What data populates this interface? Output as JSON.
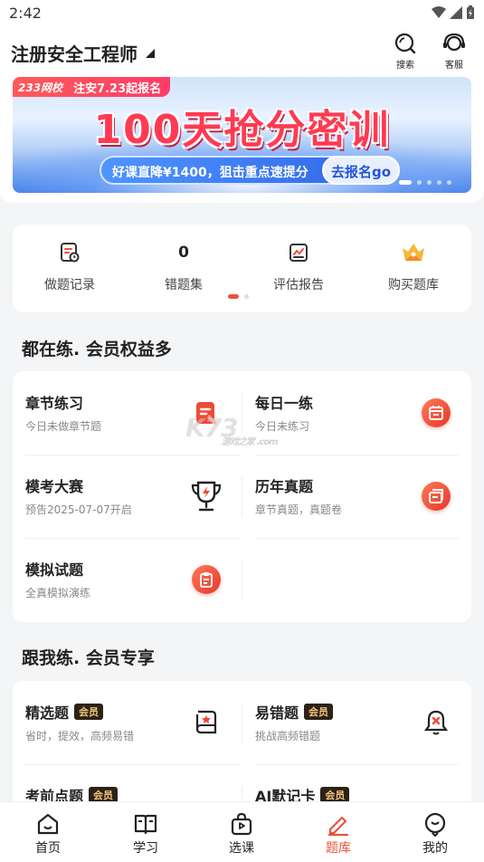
{
  "status_bar": {
    "time": "2:42"
  },
  "header": {
    "title": "注册安全工程师",
    "search_label": "搜索",
    "service_label": "客服"
  },
  "banner": {
    "logo": "233网校",
    "tag": "注安7.23起报名",
    "headline": "100天抢分密训",
    "subline": "好课直降¥1400，狙击重点速提分",
    "cta": "去报名go",
    "page_count": 5,
    "active_page": 1
  },
  "quick_actions": {
    "items": [
      {
        "icon": "record-icon",
        "label": "做题记录"
      },
      {
        "value": "0",
        "label": "错题集"
      },
      {
        "icon": "report-icon",
        "label": "评估报告"
      },
      {
        "icon": "crown-icon",
        "label": "购买题库"
      }
    ]
  },
  "section_practice": {
    "title": "都在练. 会员权益多",
    "items": [
      {
        "title": "章节练习",
        "desc": "今日未做章节题",
        "icon": "chapter-icon"
      },
      {
        "title": "每日一练",
        "desc": "今日未练习",
        "icon": "calendar-icon"
      },
      {
        "title": "模考大赛",
        "desc": "预告2025-07-07开启",
        "icon": "trophy-icon"
      },
      {
        "title": "历年真题",
        "desc": "章节真题，真题卷",
        "icon": "history-icon"
      },
      {
        "title": "模拟试题",
        "desc": "全真模拟演练",
        "icon": "clipboard-icon"
      }
    ]
  },
  "section_vip": {
    "title": "跟我练. 会员专享",
    "badge": "会员",
    "items": [
      {
        "title": "精选题",
        "desc": "省时，提效，高频易错",
        "icon": "star-doc-icon"
      },
      {
        "title": "易错题",
        "desc": "挑战高频错题",
        "icon": "bell-x-icon"
      },
      {
        "title": "考前点题",
        "icon": "exam-icon"
      },
      {
        "title": "AI默记卡",
        "icon": "sparkle-icon"
      }
    ]
  },
  "watermark": {
    "text": "K73",
    "sub": "游戏之家 .com"
  },
  "tabbar": {
    "tabs": [
      {
        "label": "首页",
        "icon": "home-icon"
      },
      {
        "label": "学习",
        "icon": "book-icon"
      },
      {
        "label": "选课",
        "icon": "bag-icon"
      },
      {
        "label": "题库",
        "icon": "pen-icon",
        "active": true
      },
      {
        "label": "我的",
        "icon": "profile-icon"
      }
    ]
  },
  "colors": {
    "accent": "#e8533e",
    "banner_blue": "#2e63e6",
    "vip_gold": "#f5c77e"
  }
}
